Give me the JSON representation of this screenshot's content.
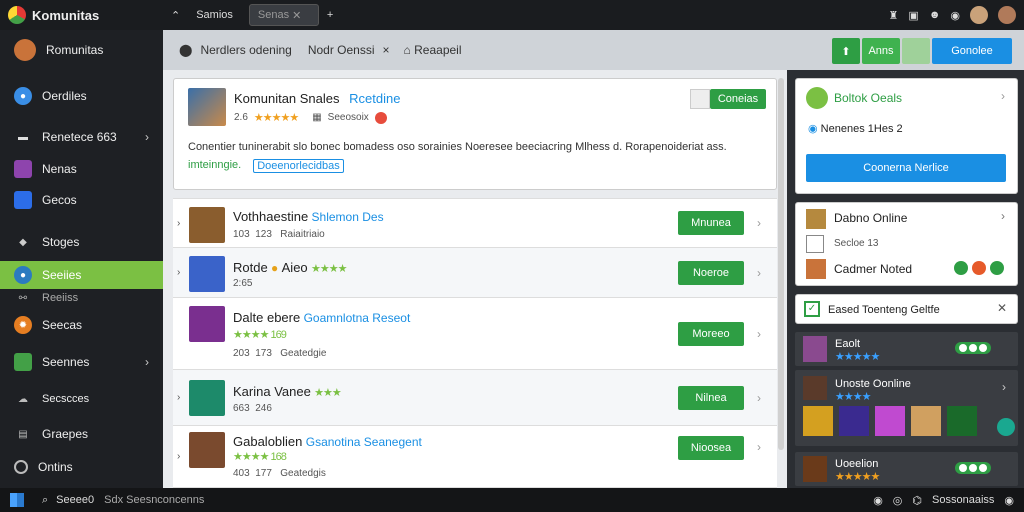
{
  "titlebar": {
    "app_name": "Komunitas",
    "tabs": [
      "Samios",
      "Senas"
    ],
    "new_tab": "+",
    "icons": [
      "shield-icon",
      "grid-icon",
      "emoji-icon",
      "globe-icon"
    ]
  },
  "sidebar": {
    "profile": "Romunitas",
    "items": [
      {
        "label": "Oerdiles",
        "icon": "user-icon",
        "color": "#3a8ee6"
      },
      {
        "label": "Renetece 663",
        "icon": "dash-icon",
        "color": "#d3d3d3",
        "chev": "›"
      },
      {
        "label": "Nenas",
        "icon": "square-icon",
        "color": "#8e44ad"
      },
      {
        "label": "Gecos",
        "icon": "bag-icon",
        "color": "#2c6de8"
      },
      {
        "label": "Stoges",
        "icon": "stack-icon",
        "color": "#bbb"
      },
      {
        "label": "Seeiies",
        "icon": "planet-icon",
        "color": "#2b7bc0",
        "active": true
      },
      {
        "label": "Reeiiss",
        "icon": "link-icon",
        "color": "#aaa"
      },
      {
        "label": "Seecas",
        "icon": "badge-icon",
        "color": "#e67e22"
      },
      {
        "label": "Seennes",
        "icon": "box-icon",
        "color": "#43a047",
        "chev": "›"
      },
      {
        "label": "Secscces",
        "icon": "cloud-icon",
        "color": "#bbb"
      },
      {
        "label": "Graepes",
        "icon": "doc-icon",
        "color": "#bbb"
      },
      {
        "label": "Ontins",
        "icon": "circle-icon",
        "color": "#bbb"
      }
    ]
  },
  "toolbar": {
    "tab1": "Nerdlers odening",
    "tab2": "Nodr Oenssi",
    "tab2_close": "×",
    "tab3": "Reaapeil",
    "btn_green_label": "Anns",
    "btn_blue_label": "Gonolee"
  },
  "featured": {
    "title": "Komunitan Snales",
    "link": "Rcetdine",
    "rating_prefix": "2.6",
    "stars": "★★★★★",
    "category": "Seeosoix",
    "description": "Conentier tuninerabit slo bonec bomadess oso sorainies Noeresee beeciacring Mlhess d. Rorapenoideriat ass.",
    "tag_green": "imteinngie.",
    "tag_blue": "Doeenorlecidbas",
    "action": "Coneias"
  },
  "rows": [
    {
      "name": "Vothhaestine",
      "link": "Shlemon Des",
      "meta1": "103",
      "meta2": "123",
      "meta3": "Raiaitriaio",
      "action": "Mnunea",
      "stars": "",
      "thumb": "#8a5d2e"
    },
    {
      "name": "Rotde",
      "link": "Aieo",
      "meta1": "2:65",
      "meta2": "",
      "meta3": "",
      "action": "Noeroe",
      "stars": "★★★★",
      "thumb": "#3a63c9"
    },
    {
      "name": "Dalte ebere",
      "link": "Goamnlotna Reseot",
      "meta1": "203",
      "meta2": "173",
      "meta3": "Geatedgie",
      "action": "Moreeo",
      "stars": "★★★★ 169",
      "thumb": "#7a2f8f"
    },
    {
      "name": "Karina Vanee",
      "link": "",
      "meta1": "663",
      "meta2": "246",
      "meta3": "",
      "action": "Nilnea",
      "stars": "★★★",
      "thumb": "#1d8a6a"
    },
    {
      "name": "Gabaloblien",
      "link": "Gsanotina Seanegent",
      "meta1": "403",
      "meta2": "177",
      "meta3": "Geatedgis",
      "action": "Nioosea",
      "stars": "★★★★ 168",
      "thumb": "#7a4a2e"
    }
  ],
  "right": {
    "online": {
      "title": "Boltok Oeals",
      "sub": "Nenenes 1Hes 2",
      "button": "Coonerna Nerlice"
    },
    "card2": {
      "line1": "Dabno Online",
      "line2": "Secloe 13",
      "line3": "Cadmer Noted"
    },
    "notice": "Eased Toenteng Geltfe",
    "friends": [
      {
        "name": "Eaolt",
        "stars": "★★★★★"
      },
      {
        "name": "Unoste Oonline",
        "stars": "★★★★"
      },
      {
        "name": "Uoeelion",
        "stars": "★★★★★"
      }
    ]
  },
  "taskbar": {
    "search": "Seeee0",
    "search_hint": "Sdx Seesnconcenns",
    "tray": "Sossonaaiss"
  }
}
